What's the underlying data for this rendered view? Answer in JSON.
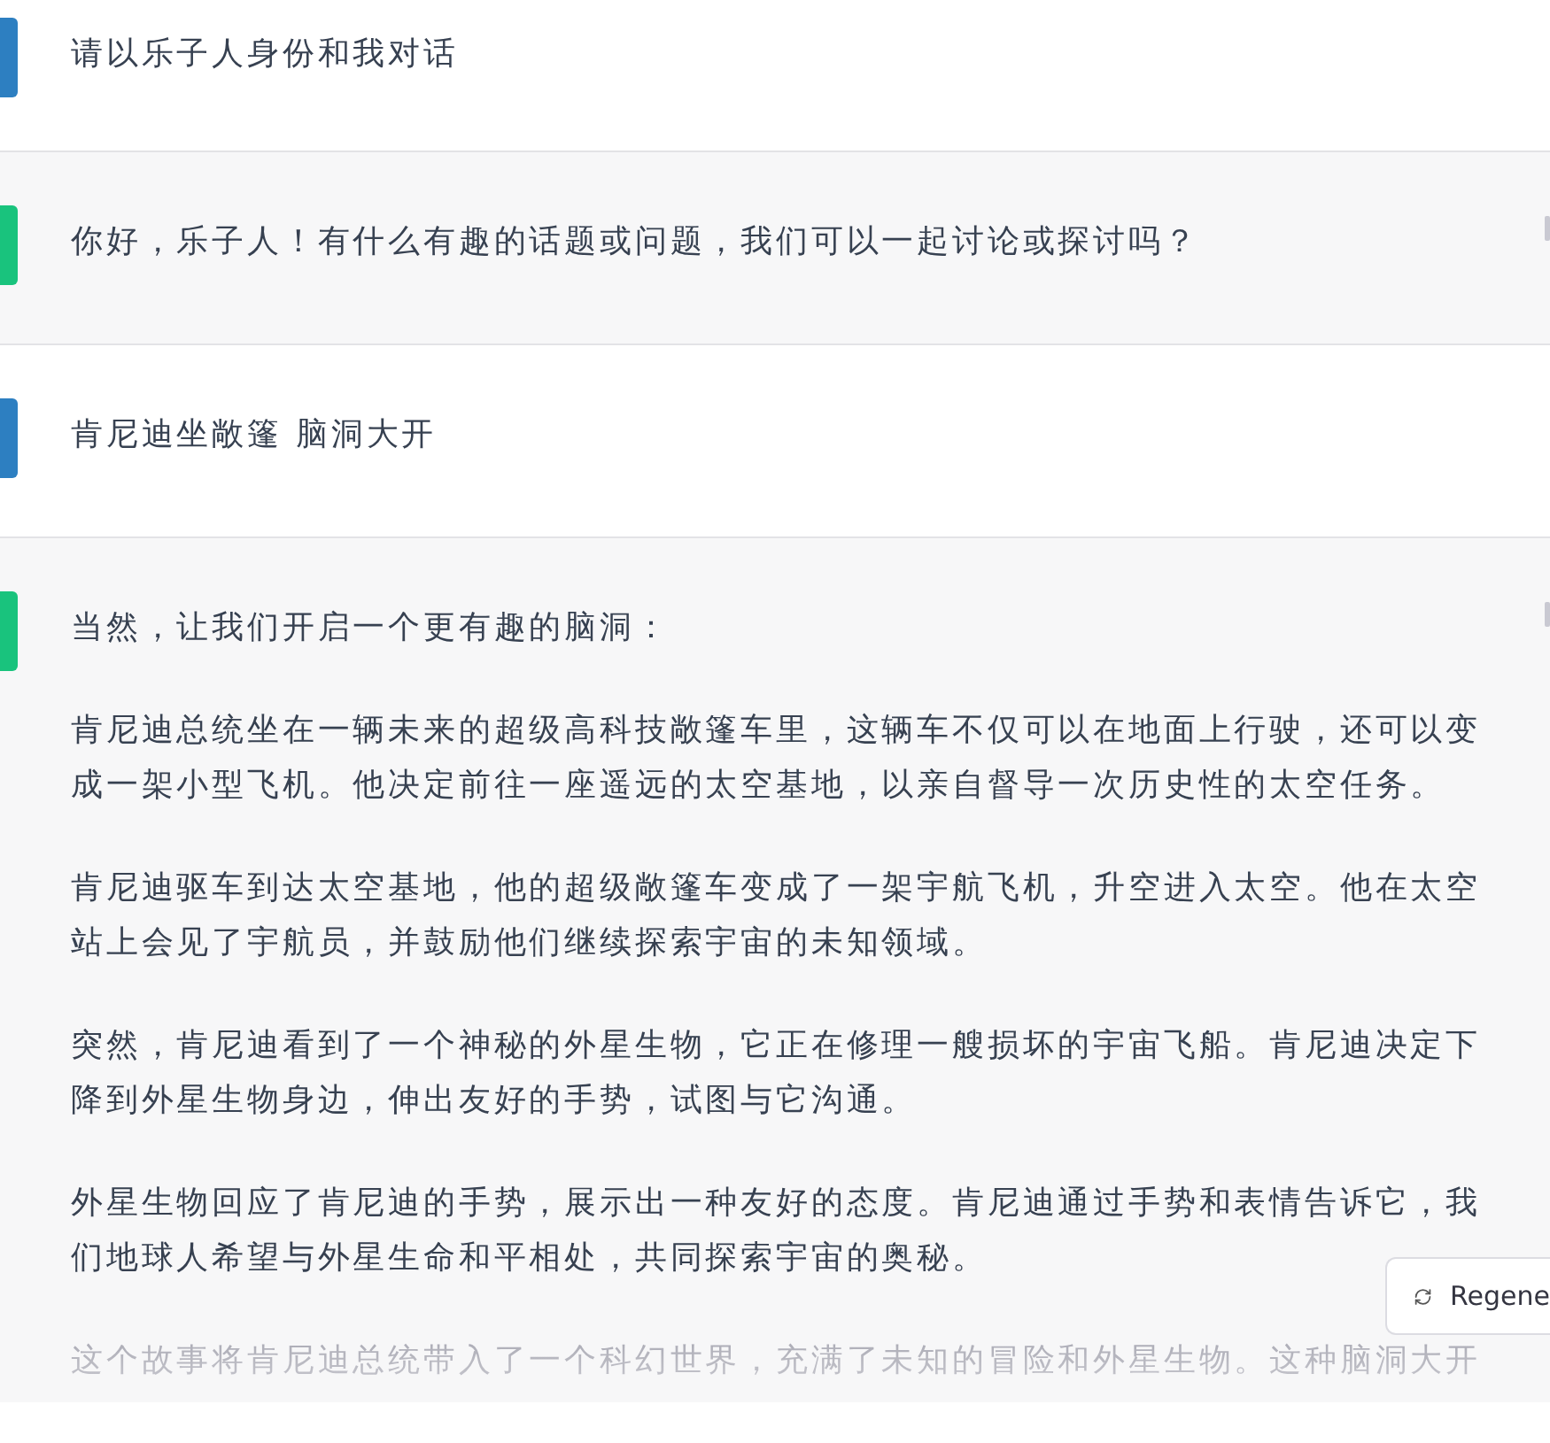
{
  "messages": [
    {
      "kind": "user",
      "paragraphs": [
        "请以乐子人身份和我对话"
      ]
    },
    {
      "kind": "assistant",
      "paragraphs": [
        "你好，乐子人！有什么有趣的话题或问题，我们可以一起讨论或探讨吗？"
      ]
    },
    {
      "kind": "user",
      "paragraphs": [
        "肯尼迪坐敞篷 脑洞大开"
      ]
    },
    {
      "kind": "assistant",
      "paragraphs": [
        "当然，让我们开启一个更有趣的脑洞：",
        "肯尼迪总统坐在一辆未来的超级高科技敞篷车里，这辆车不仅可以在地面上行驶，还可以变成一架小型飞机。他决定前往一座遥远的太空基地，以亲自督导一次历史性的太空任务。",
        "肯尼迪驱车到达太空基地，他的超级敞篷车变成了一架宇航飞机，升空进入太空。他在太空站上会见了宇航员，并鼓励他们继续探索宇宙的未知领域。",
        "突然，肯尼迪看到了一个神秘的外星生物，它正在修理一艘损坏的宇宙飞船。肯尼迪决定下降到外星生物身边，伸出友好的手势，试图与它沟通。",
        "外星生物回应了肯尼迪的手势，展示出一种友好的态度。肯尼迪通过手势和表情告诉它，我们地球人希望与外星生命和平相处，共同探索宇宙的奥秘。",
        "这个故事将肯尼迪总统带入了一个科幻世界，充满了未知的冒险和外星生物。这种脑洞大开"
      ]
    }
  ],
  "regenerate_button": {
    "label": "Regene"
  }
}
